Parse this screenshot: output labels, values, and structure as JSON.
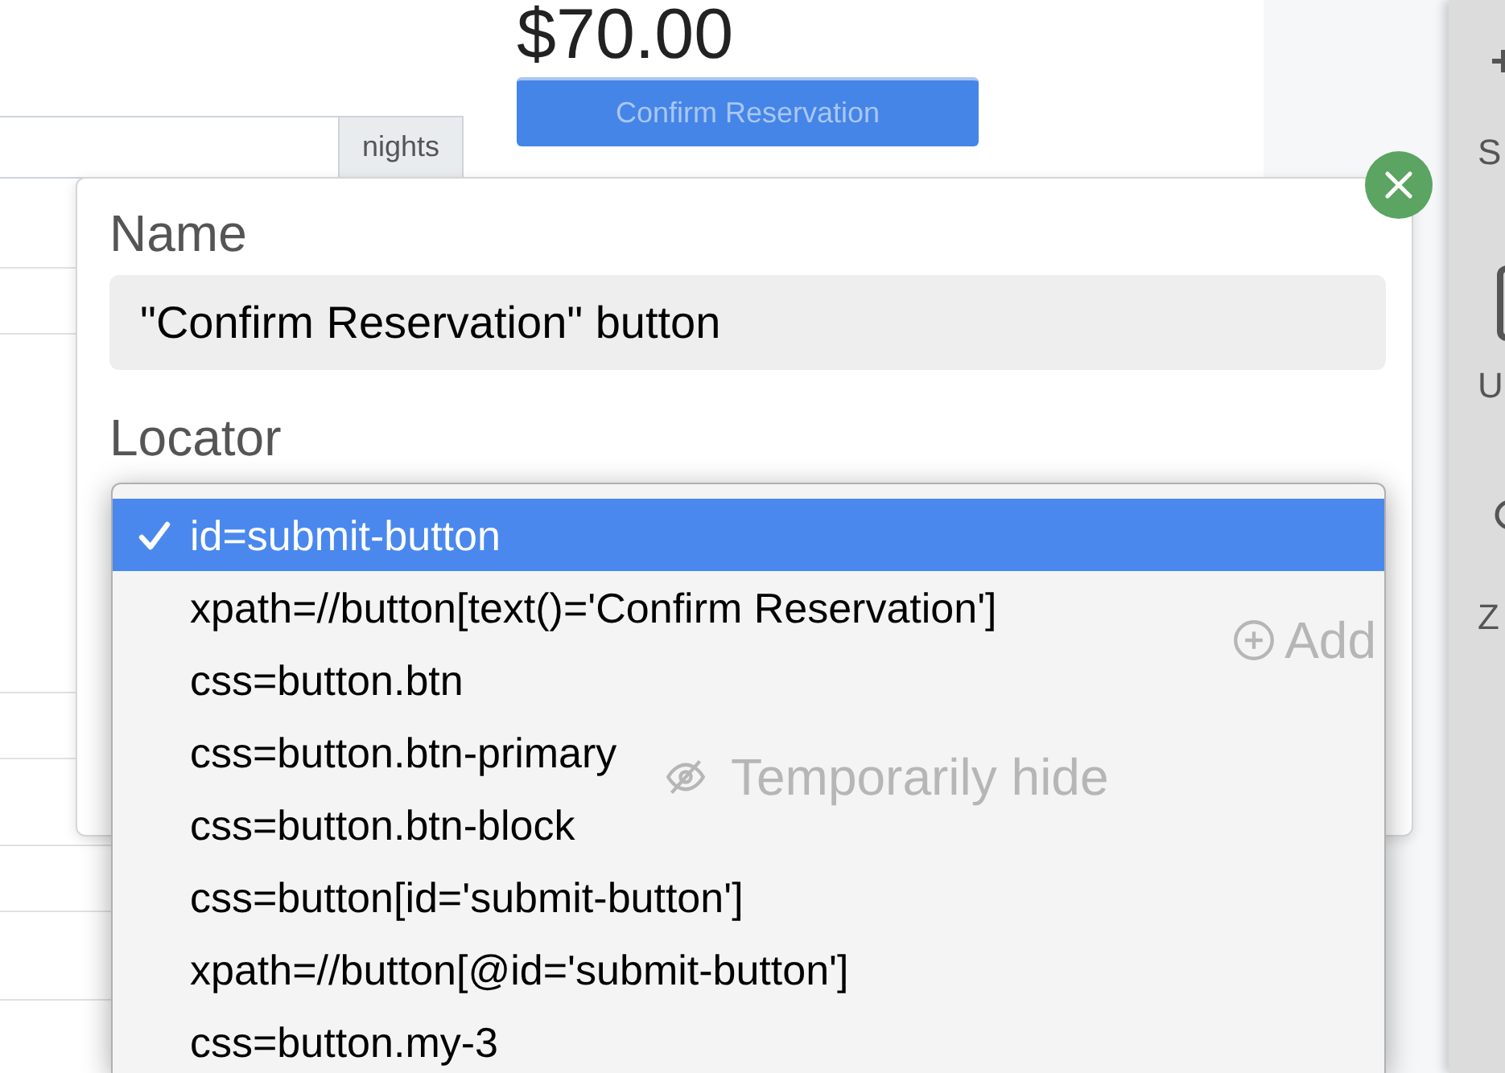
{
  "background_page": {
    "price": "$70.00",
    "confirm_button": {
      "label": "Confirm Reservation",
      "disabled": true
    },
    "nights_addon": "nights"
  },
  "right_panel": {
    "labels": [
      "S",
      "U",
      "Z"
    ]
  },
  "dialog": {
    "name_label": "Name",
    "name_value": "\"Confirm Reservation\" button",
    "locator_label": "Locator",
    "add_button": "Add",
    "hide_toggle": "Temporarily hide"
  },
  "locator_dropdown": {
    "options": [
      {
        "label": "id=submit-button",
        "selected": true
      },
      {
        "label": "xpath=//button[text()='Confirm Reservation']",
        "selected": false
      },
      {
        "label": "css=button.btn",
        "selected": false
      },
      {
        "label": "css=button.btn-primary",
        "selected": false
      },
      {
        "label": "css=button.btn-block",
        "selected": false
      },
      {
        "label": "css=button[id='submit-button']",
        "selected": false
      },
      {
        "label": "xpath=//button[@id='submit-button']",
        "selected": false
      },
      {
        "label": "css=button.my-3",
        "selected": false
      }
    ]
  }
}
